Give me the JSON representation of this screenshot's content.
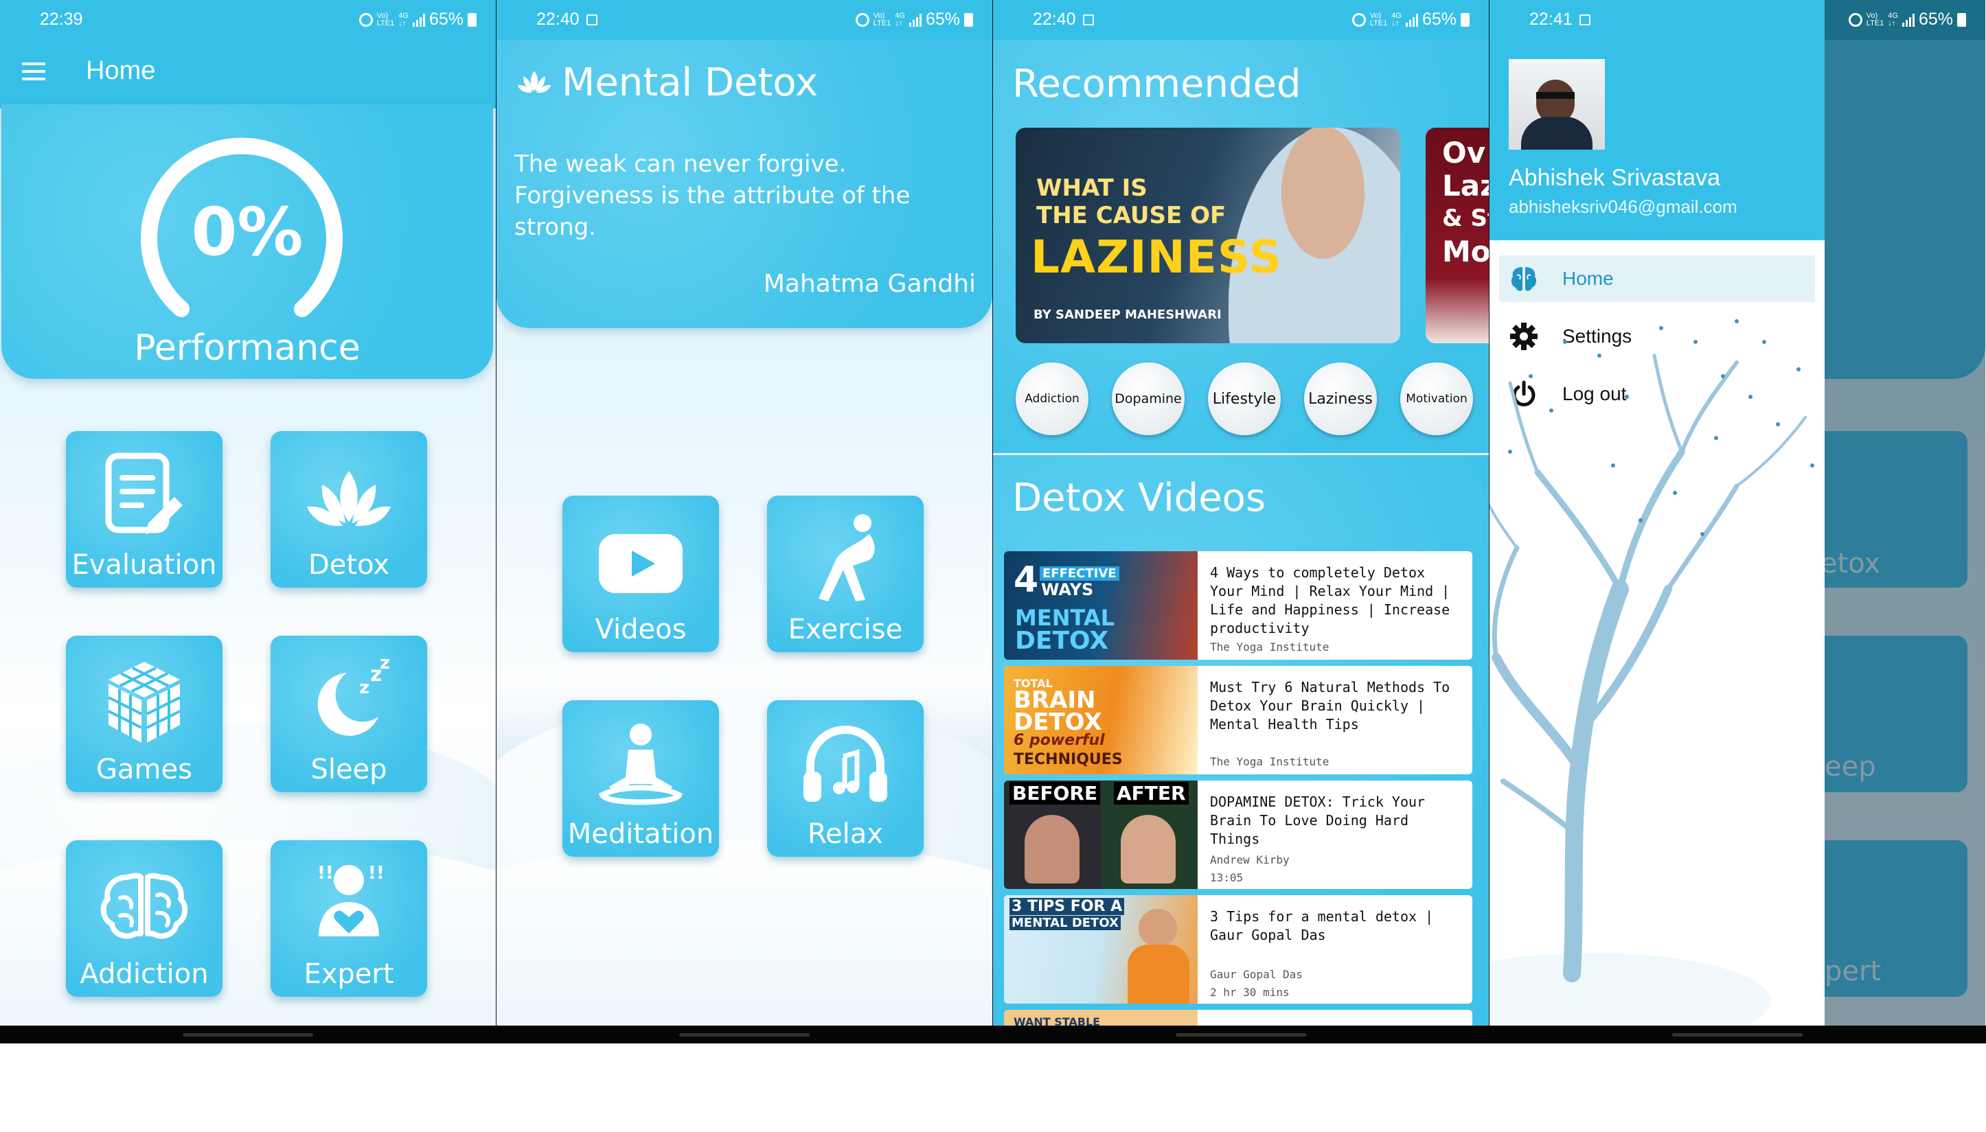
{
  "screens": [
    {
      "status": {
        "time": "22:39",
        "battery": "65%"
      },
      "app_bar": {
        "title": "Home",
        "menu_icon": "hamburger-menu-icon"
      },
      "performance": {
        "value": "0%",
        "label": "Performance"
      },
      "tiles": [
        {
          "label": "Evaluation",
          "icon": "edit-document-icon"
        },
        {
          "label": "Detox",
          "icon": "lotus-icon"
        },
        {
          "label": "Games",
          "icon": "cube-icon"
        },
        {
          "label": "Sleep",
          "icon": "moon-zzz-icon"
        },
        {
          "label": "Addiction",
          "icon": "brain-icon"
        },
        {
          "label": "Expert",
          "icon": "person-heart-icon"
        }
      ]
    },
    {
      "status": {
        "time": "22:40",
        "battery": "65%"
      },
      "header": {
        "title": "Mental Detox",
        "icon": "lotus-icon"
      },
      "quote": {
        "text": "The weak can never forgive. Forgiveness is the attribute of the strong.",
        "author": "Mahatma Gandhi"
      },
      "tiles": [
        {
          "label": "Videos",
          "icon": "play-button-icon"
        },
        {
          "label": "Exercise",
          "icon": "stretching-person-icon"
        },
        {
          "label": "Meditation",
          "icon": "meditation-person-icon"
        },
        {
          "label": "Relax",
          "icon": "headphones-music-icon"
        }
      ]
    },
    {
      "status": {
        "time": "22:40",
        "battery": "65%"
      },
      "recommended": {
        "title": "Recommended",
        "featured": {
          "line1": "WHAT IS",
          "line2": "THE CAUSE OF",
          "line3": "LAZINESS",
          "byline": "BY SANDEEP MAHESHWARI"
        },
        "second": {
          "lines": [
            "Ov",
            "Laz",
            "& St",
            "Mot"
          ]
        },
        "chips": [
          "Addiction",
          "Dopamine",
          "Lifestyle",
          "Laziness",
          "Motivation"
        ]
      },
      "detox_videos": {
        "title": "Detox Videos",
        "items": [
          {
            "title": "4 Ways to completely Detox Your Mind | Relax Your Mind | Life and Happiness | Increase productivity",
            "channel": "The Yoga Institute",
            "duration": "",
            "thumb": [
              "4",
              "EFFECTIVE",
              "WAYS",
              "MENTAL",
              "DETOX"
            ]
          },
          {
            "title": "Must Try 6 Natural Methods To Detox Your Brain Quickly | Mental Health Tips",
            "channel": "The Yoga Institute",
            "duration": "",
            "thumb": [
              "TOTAL",
              "BRAIN",
              "DETOX",
              "6 powerful",
              "TECHNIQUES"
            ]
          },
          {
            "title": "DOPAMINE DETOX: Trick Your Brain To Love Doing Hard Things",
            "channel": "Andrew Kirby",
            "duration": "13:05",
            "thumb": [
              "BEFORE",
              "AFTER"
            ]
          },
          {
            "title": "3 Tips for a mental detox | Gaur Gopal Das",
            "channel": "Gaur Gopal Das",
            "duration": "2 hr 30 mins",
            "thumb": [
              "3 TIPS FOR A",
              "MENTAL DETOX"
            ]
          }
        ],
        "partial_next": "WANT STABLE"
      }
    },
    {
      "status": {
        "time": "22:41",
        "battery": "65%"
      },
      "drawer": {
        "user_name": "Abhishek Srivastava",
        "email": "abhisheksriv046@gmail.com",
        "items": [
          {
            "label": "Home",
            "icon": "brain-icon",
            "active": true
          },
          {
            "label": "Settings",
            "icon": "gear-icon",
            "active": false
          },
          {
            "label": "Log out",
            "icon": "power-icon",
            "active": false
          }
        ]
      },
      "behind_labels": [
        "etox",
        "eep",
        "pert"
      ]
    }
  ],
  "colors": {
    "primary": "#36c0e8",
    "tile": "#40c2ea",
    "drawer_active": "#e3f2f7",
    "drawer_active_text": "#2196c4"
  }
}
